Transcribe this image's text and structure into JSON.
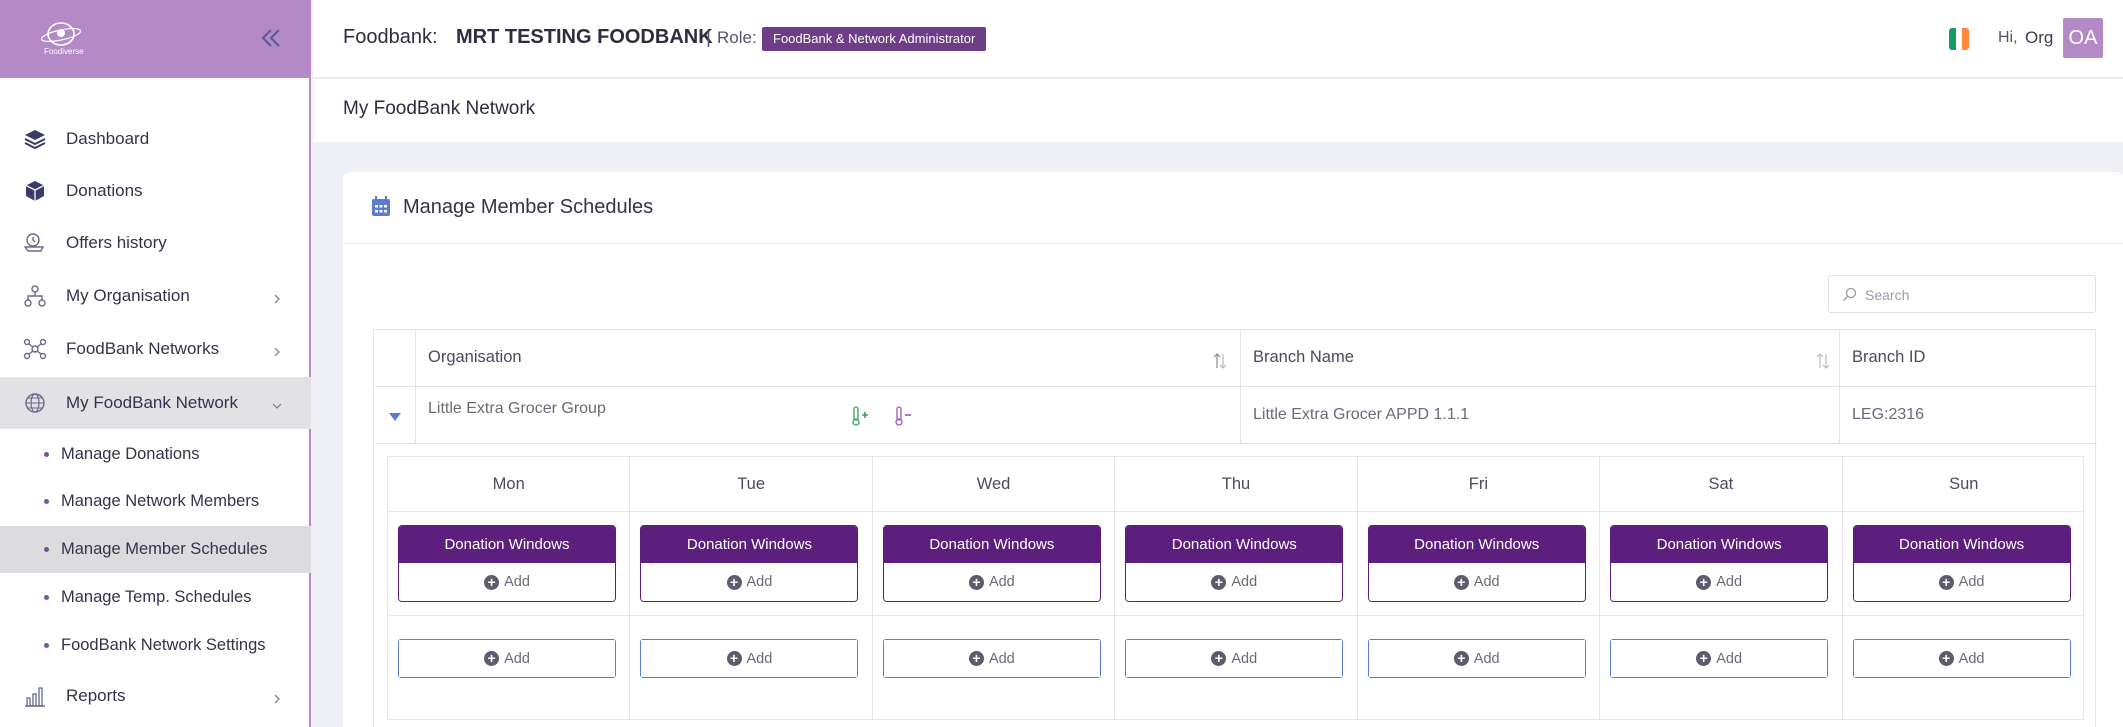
{
  "sidebar": {
    "logo_text": "Foodiverse",
    "items": [
      {
        "label": "Dashboard",
        "icon": "layers-icon"
      },
      {
        "label": "Donations",
        "icon": "box-icon"
      },
      {
        "label": "Offers history",
        "icon": "cart-history-icon"
      },
      {
        "label": "My Organisation",
        "icon": "org-chart-icon"
      },
      {
        "label": "FoodBank Networks",
        "icon": "network-icon"
      },
      {
        "label": "My FoodBank Network",
        "icon": "globe-icon"
      }
    ],
    "subitems": [
      {
        "label": "Manage Donations"
      },
      {
        "label": "Manage Network Members"
      },
      {
        "label": "Manage Member Schedules"
      },
      {
        "label": "Manage Temp. Schedules"
      },
      {
        "label": "FoodBank Network Settings"
      }
    ],
    "reports": {
      "label": "Reports",
      "icon": "bar-chart-icon"
    }
  },
  "topbar": {
    "foodbank_label": "Foodbank:",
    "foodbank_name": "MRT TESTING FOODBANK",
    "separator": "|",
    "role_label": "Role:",
    "role_badge": "FoodBank & Network Administrator",
    "greeting": "Hi,",
    "user": "Org",
    "avatar": "OA",
    "flag_colors": [
      "#169b62",
      "#ffffff",
      "#ff883e"
    ]
  },
  "page": {
    "title": "My FoodBank Network"
  },
  "card": {
    "title": "Manage Member Schedules",
    "search_placeholder": "Search"
  },
  "table": {
    "columns": [
      "Organisation",
      "Branch Name",
      "Branch ID"
    ],
    "row": {
      "organisation": "Little Extra Grocer Group",
      "branch_name": "Little Extra Grocer APPD 1.1.1",
      "branch_id": "LEG:2316"
    }
  },
  "schedule": {
    "days": [
      "Mon",
      "Tue",
      "Wed",
      "Thu",
      "Fri",
      "Sat",
      "Sun"
    ],
    "window_title": "Donation Windows",
    "add_label": "Add"
  },
  "colors": {
    "sidebar_header": "#b48ac6",
    "accent": "#5c1f7e",
    "badge": "#6e3d87",
    "link_blue": "#5b7bd5"
  }
}
